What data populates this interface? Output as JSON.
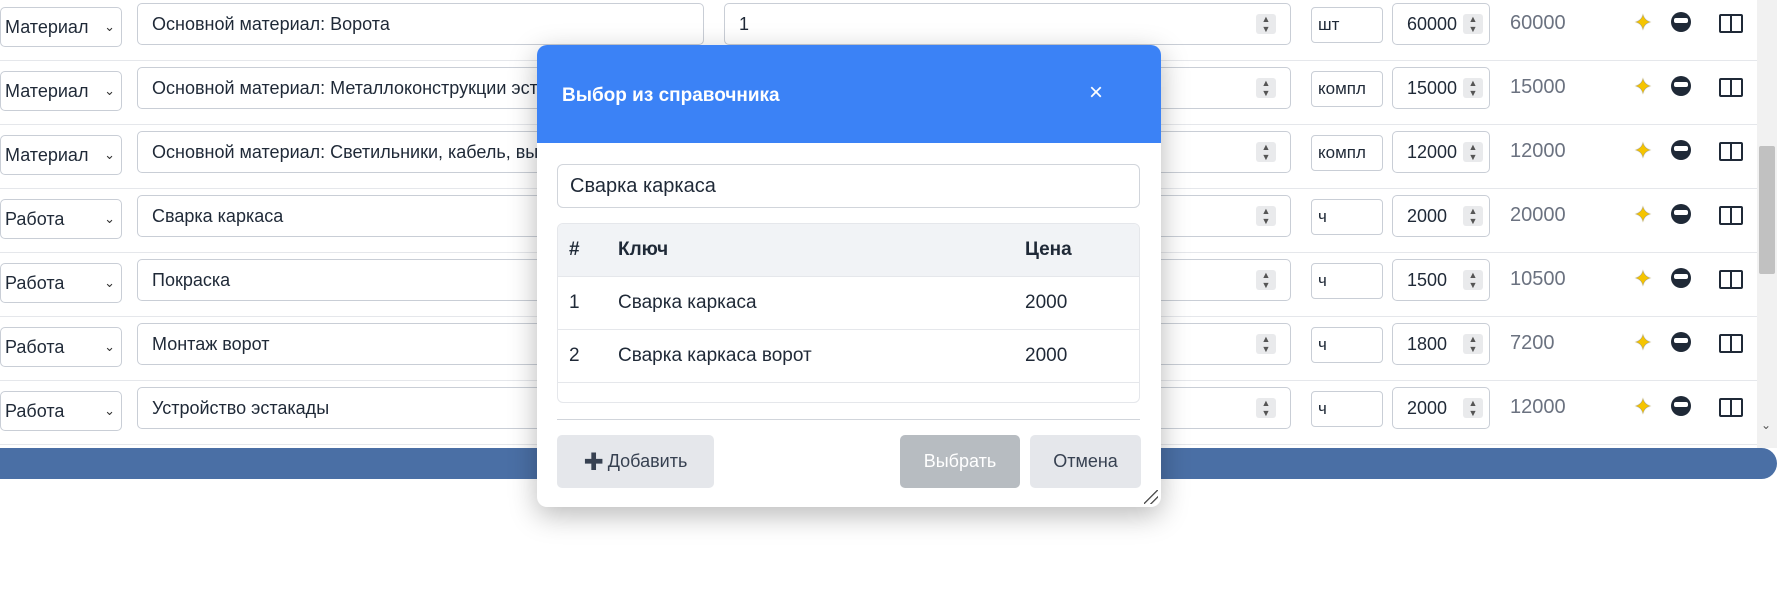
{
  "rows": [
    {
      "type": "Материал",
      "name": "Основной материал: Ворота",
      "qty": "1",
      "unit": "шт",
      "price": "60000",
      "sum": "60000"
    },
    {
      "type": "Материал",
      "name": "Основной материал: Металлоконструкции эста",
      "qty": "",
      "unit": "компл",
      "price": "15000",
      "sum": "15000"
    },
    {
      "type": "Материал",
      "name": "Основной материал: Светильники, кабель, вык",
      "qty": "",
      "unit": "компл",
      "price": "12000",
      "sum": "12000"
    },
    {
      "type": "Работа",
      "name": "Сварка каркаса",
      "qty": "",
      "unit": "ч",
      "price": "2000",
      "sum": "20000"
    },
    {
      "type": "Работа",
      "name": "Покраска",
      "qty": "",
      "unit": "ч",
      "price": "1500",
      "sum": "10500"
    },
    {
      "type": "Работа",
      "name": "Монтаж ворот",
      "qty": "",
      "unit": "ч",
      "price": "1800",
      "sum": "7200"
    },
    {
      "type": "Работа",
      "name": "Устройство эстакады",
      "qty": "",
      "unit": "ч",
      "price": "2000",
      "sum": "12000"
    }
  ],
  "icons": {
    "magic": "sparkle-icon",
    "bot": "robot-icon",
    "book": "book-icon"
  },
  "modal": {
    "title": "Выбор из справочника",
    "close": "×",
    "search_value": "Сварка каркаса",
    "columns": {
      "num": "#",
      "key": "Ключ",
      "price": "Цена"
    },
    "items": [
      {
        "num": "1",
        "key": "Сварка каркаса",
        "price": "2000"
      },
      {
        "num": "2",
        "key": "Сварка каркаса ворот",
        "price": "2000"
      }
    ],
    "buttons": {
      "add": "Добавить",
      "select": "Выбрать",
      "cancel": "Отмена"
    }
  },
  "colors": {
    "accent": "#3b82f6",
    "bar": "#4a6fa5"
  }
}
